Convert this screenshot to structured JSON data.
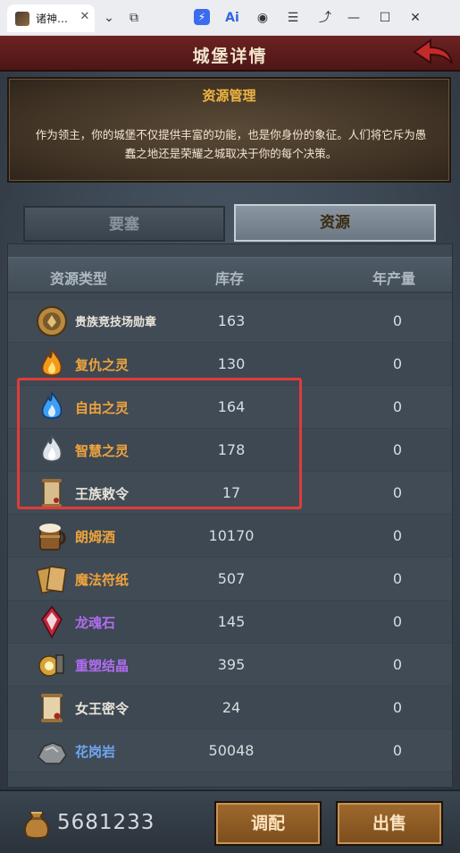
{
  "browser": {
    "tab_title": "诸神…",
    "tab_close": "✕",
    "controls": [
      "⌄",
      "⧉",
      "⚡",
      "Ai",
      "◉",
      "☰",
      "⤴",
      "—",
      "☐",
      "✕"
    ]
  },
  "game": {
    "title": "城堡详情",
    "resource_panel": {
      "title": "资源管理",
      "description": "作为领主，你的城堡不仅提供丰富的功能，也是你身份的象征。人们将它斥为愚蠢之地还是荣耀之城取决于你的每个决策。"
    },
    "tabs": [
      {
        "label": "要塞",
        "active": false
      },
      {
        "label": "资源",
        "active": true
      }
    ],
    "table": {
      "headers": [
        "资源类型",
        "库存",
        "年产量"
      ],
      "rows": [
        {
          "name": "贵族竞技场勋章",
          "stock": "163",
          "yearly": "0",
          "color": "#e8e3d9",
          "icon": "medal-icon"
        },
        {
          "name": "复仇之灵",
          "stock": "130",
          "yearly": "0",
          "color": "#f0a33c",
          "icon": "orange-flame-icon"
        },
        {
          "name": "自由之灵",
          "stock": "164",
          "yearly": "0",
          "color": "#f0a33c",
          "icon": "blue-flame-icon"
        },
        {
          "name": "智慧之灵",
          "stock": "178",
          "yearly": "0",
          "color": "#f0a33c",
          "icon": "white-flame-icon"
        },
        {
          "name": "王族敕令",
          "stock": "17",
          "yearly": "0",
          "color": "#e8e3d9",
          "icon": "scroll-icon"
        },
        {
          "name": "朗姆酒",
          "stock": "10170",
          "yearly": "0",
          "color": "#f0a33c",
          "icon": "beer-mug-icon"
        },
        {
          "name": "魔法符纸",
          "stock": "507",
          "yearly": "0",
          "color": "#f0a33c",
          "icon": "talisman-paper-icon"
        },
        {
          "name": "龙魂石",
          "stock": "145",
          "yearly": "0",
          "color": "#b06cf0",
          "icon": "dragon-soul-stone-icon"
        },
        {
          "name": "重塑结晶",
          "stock": "395",
          "yearly": "0",
          "color": "#b06cf0",
          "icon": "reforge-crystal-icon"
        },
        {
          "name": "女王密令",
          "stock": "24",
          "yearly": "0",
          "color": "#e8e3d9",
          "icon": "queen-scroll-icon"
        },
        {
          "name": "花岗岩",
          "stock": "50048",
          "yearly": "0",
          "color": "#6fa6f0",
          "icon": "granite-icon"
        }
      ]
    },
    "footer": {
      "gold": "5681233",
      "adjust_label": "调配",
      "sell_label": "出售"
    }
  }
}
